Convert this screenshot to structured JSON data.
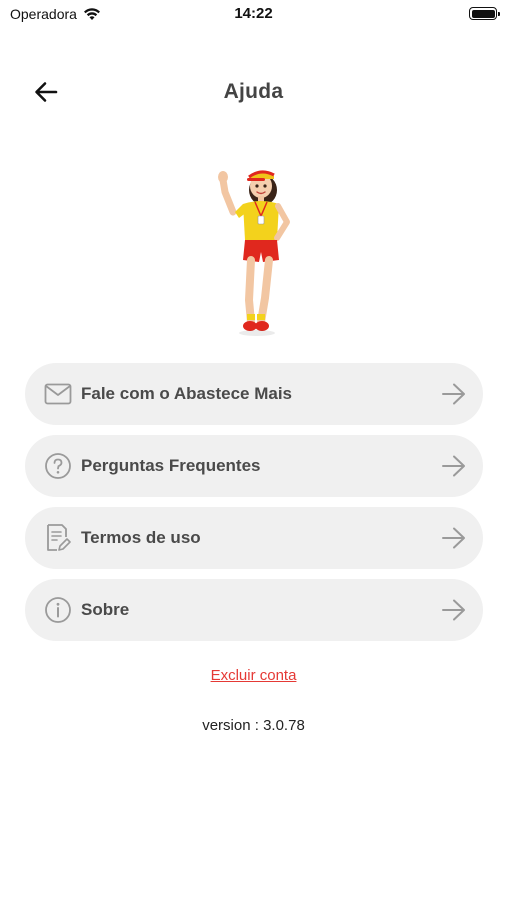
{
  "status_bar": {
    "carrier": "Operadora",
    "time": "14:22",
    "icons": [
      "wifi-icon",
      "battery-icon"
    ]
  },
  "header": {
    "title": "Ajuda",
    "back_icon": "arrow-left-icon"
  },
  "mascot": {
    "description_icon": "mascot-illustration"
  },
  "menu": {
    "items": [
      {
        "label": "Fale com o Abastece Mais",
        "icon": "mail-icon"
      },
      {
        "label": "Perguntas Frequentes",
        "icon": "question-icon"
      },
      {
        "label": "Termos de uso",
        "icon": "document-edit-icon"
      },
      {
        "label": "Sobre",
        "icon": "info-icon"
      }
    ],
    "arrow_icon": "arrow-right-icon"
  },
  "footer": {
    "delete_account_label": "Excluir conta",
    "version_text": "version : 3.0.78"
  },
  "colors": {
    "background": "#ffffff",
    "menu_item_bg": "#f0f0f0",
    "text": "#4a4a4a",
    "danger": "#e53935",
    "icon_gray": "#9a9a9a"
  }
}
